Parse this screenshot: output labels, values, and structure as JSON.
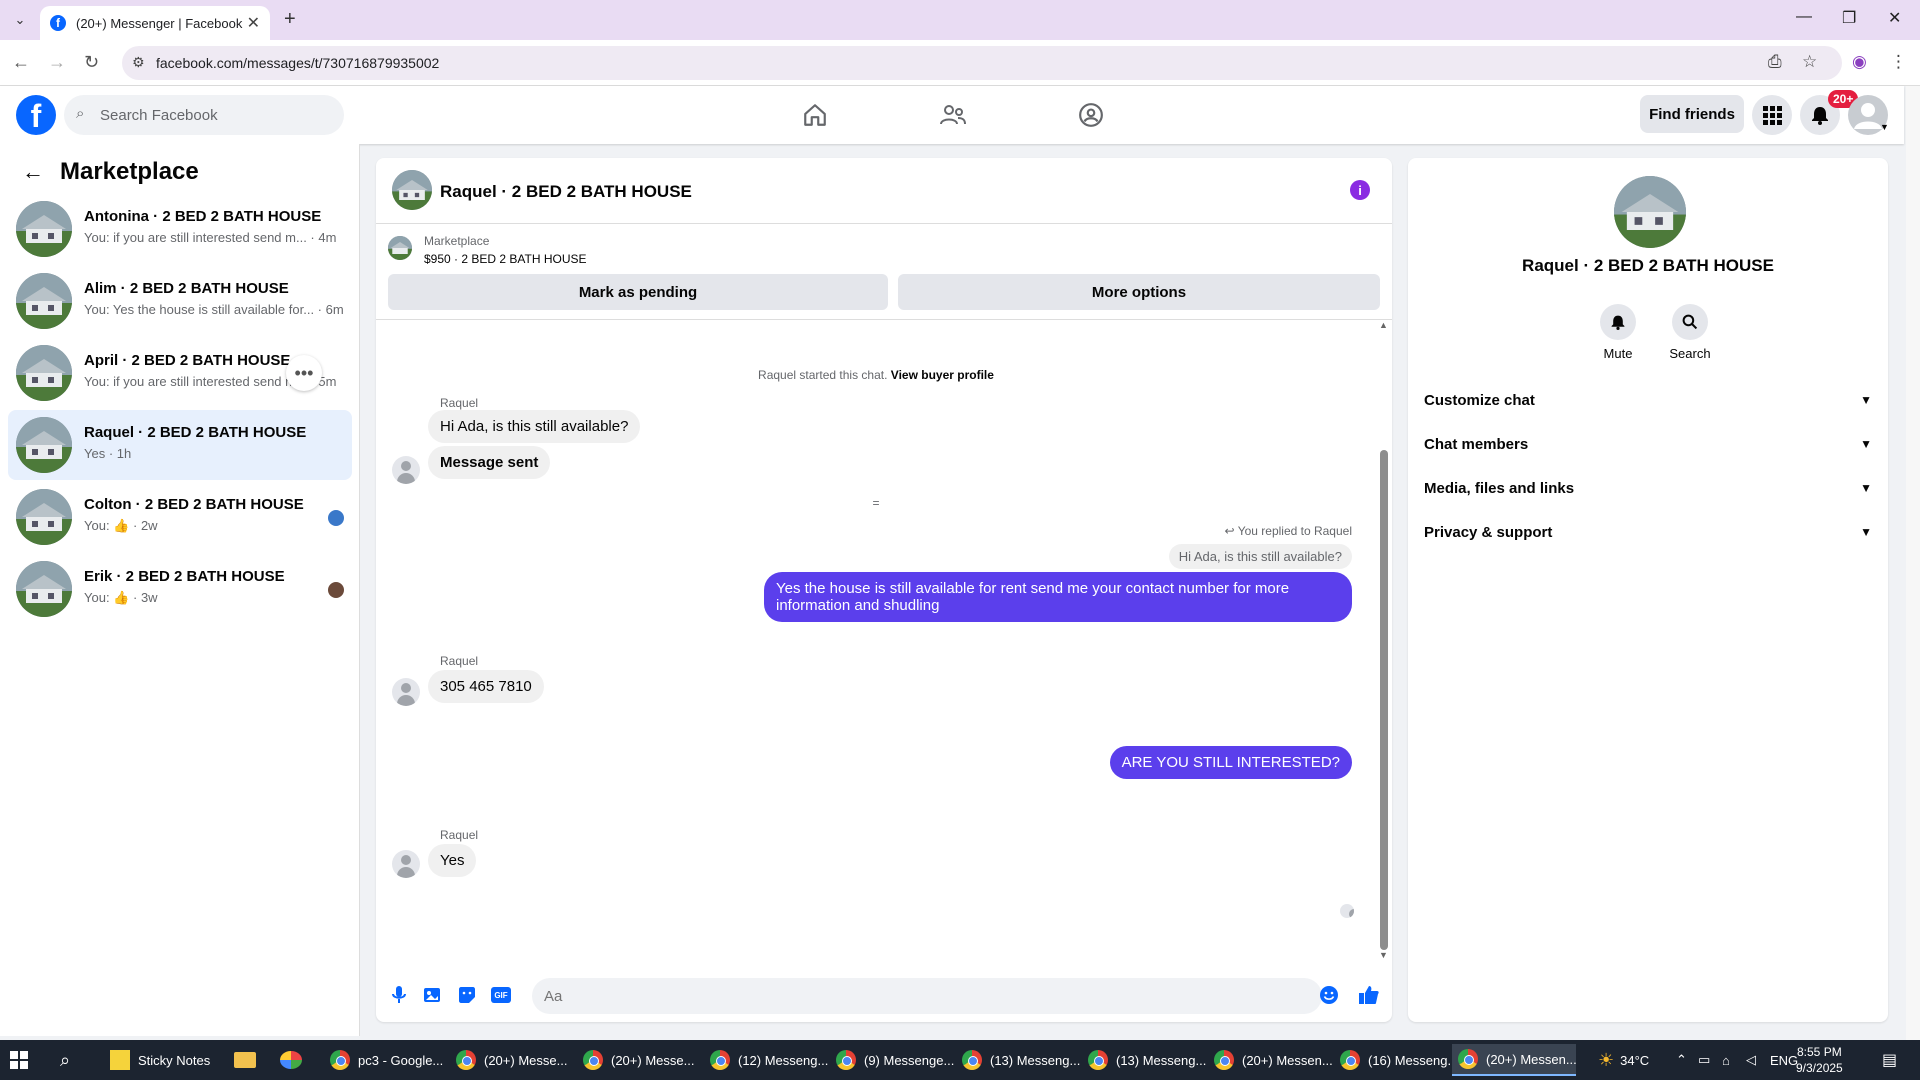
{
  "browser": {
    "tab_title": "(20+) Messenger | Facebook",
    "url": "facebook.com/messages/t/730716879935002"
  },
  "fb": {
    "search_placeholder": "Search Facebook",
    "find_friends": "Find friends",
    "notif_badge": "20+",
    "brand_color": "#0866ff"
  },
  "sidebar": {
    "title": "Marketplace",
    "conversations": [
      {
        "name": "Antonina · 2 BED 2 BATH HOUSE",
        "preview": "You: if you are still interested send m... · 4m"
      },
      {
        "name": "Alim · 2 BED 2 BATH HOUSE",
        "preview": "You: Yes the house is still available for... · 6m"
      },
      {
        "name": "April · 2 BED 2 BATH HOUSE",
        "preview": "You: if you are still interested send m... · 5m"
      },
      {
        "name": "Raquel · 2 BED 2 BATH HOUSE",
        "preview": "Yes · 1h"
      },
      {
        "name": "Colton · 2 BED 2 BATH HOUSE",
        "preview_prefix": "You:",
        "preview_suffix": "· 2w"
      },
      {
        "name": "Erik · 2 BED 2 BATH HOUSE",
        "preview_prefix": "You:",
        "preview_suffix": "· 3w"
      }
    ]
  },
  "chat": {
    "title": "Raquel · 2 BED 2 BATH HOUSE",
    "listing_label": "Marketplace",
    "listing_price_title": "$950 · 2 BED 2 BATH HOUSE",
    "mark_pending": "Mark as pending",
    "more_options": "More options",
    "started_text": "Raquel started this chat.",
    "view_buyer_profile": "View buyer profile",
    "sender_name": "Raquel",
    "msg1": "Hi Ada, is this still available?",
    "msg2": "Message sent",
    "separator": "=",
    "replied_label": "You replied to Raquel",
    "quoted": "Hi Ada, is this still available?",
    "reply_out": "Yes the house is still available for rent send me your contact number for more information and shudling",
    "msg_phone": "305 465 7810",
    "msg_out2": "ARE YOU STILL INTERESTED?",
    "msg_yes": "Yes",
    "input_placeholder": "Aa",
    "outgoing_color": "#5b3fec"
  },
  "info_panel": {
    "name": "Raquel · 2 BED 2 BATH HOUSE",
    "mute": "Mute",
    "search": "Search",
    "sections": [
      "Customize chat",
      "Chat members",
      "Media, files and links",
      "Privacy & support"
    ]
  },
  "taskbar": {
    "apps": [
      "Sticky Notes",
      "pc3 - Google...",
      "(20+) Messe...",
      "(20+) Messe...",
      "(12) Messeng...",
      "(9) Messenge...",
      "(13) Messeng...",
      "(13) Messeng...",
      "(20+) Messen...",
      "(16) Messeng...",
      "(20+) Messen..."
    ],
    "temperature": "34°C",
    "language": "ENG",
    "time": "8:55 PM",
    "date": "9/3/2025"
  }
}
